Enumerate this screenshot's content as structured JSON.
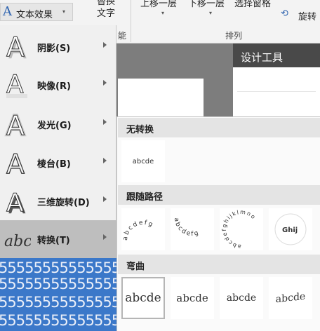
{
  "ribbon": {
    "text_effects": "文本效果",
    "replace_text_line1": "替换",
    "replace_text_line2": "文字",
    "group_partial": "能",
    "bring_forward": "上移一层",
    "send_backward": "下移一层",
    "selection_pane": "选择窗格",
    "rotate": "旋转",
    "arrange_group": "排列"
  },
  "design_tools": "设计工具",
  "menu": {
    "items": [
      {
        "label": "阴影(S)",
        "icon": "letter-a-shadow-icon"
      },
      {
        "label": "映像(R)",
        "icon": "letter-a-reflection-icon"
      },
      {
        "label": "发光(G)",
        "icon": "letter-a-glow-icon"
      },
      {
        "label": "棱台(B)",
        "icon": "letter-a-bevel-icon"
      },
      {
        "label": "三维旋转(D)",
        "icon": "letter-a-3d-rotation-icon"
      },
      {
        "label": "转换(T)",
        "icon": "abc-transform-icon",
        "active": true
      }
    ]
  },
  "submenu": {
    "no_transform": "无转换",
    "no_transform_sample": "abcde",
    "follow_path": "跟随路径",
    "follow_path_samples": [
      "abcdefg",
      "abcdefg",
      "abcdefghijklmno",
      "Ghij"
    ],
    "warp": "弯曲",
    "warp_samples": [
      "abcde",
      "abcde",
      "abcde",
      "abcde"
    ]
  },
  "document_text": {
    "digits_line": "5555555555555555"
  },
  "colors": {
    "ribbon_bg": "#f3f3f3",
    "menu_bg": "#f0f0f0",
    "active_item": "#bebebe",
    "doc_blue": "#3b78c9",
    "section_header": "#e4e4e4",
    "design_header": "#494949"
  }
}
